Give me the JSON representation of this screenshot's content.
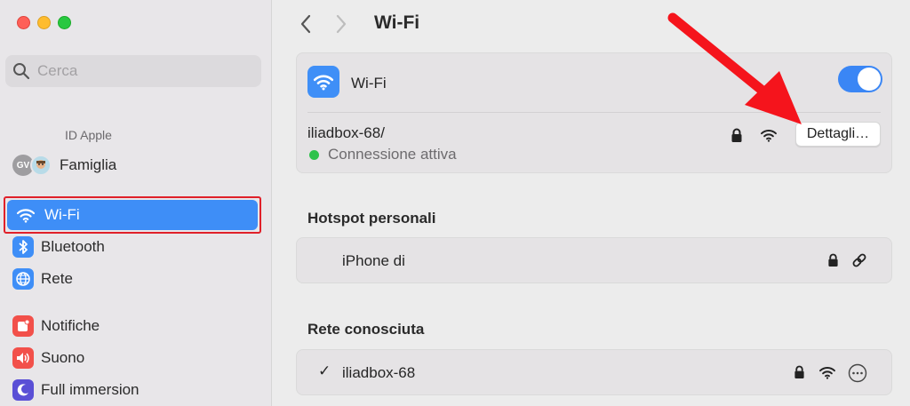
{
  "sidebar": {
    "search_placeholder": "Cerca",
    "apple_id_label": "ID Apple",
    "family": {
      "avatar_initials": "GV",
      "label": "Famiglia"
    },
    "items": [
      {
        "label": "Wi-Fi",
        "icon": "wifi-icon",
        "selected": true
      },
      {
        "label": "Bluetooth",
        "icon": "bluetooth-icon"
      },
      {
        "label": "Rete",
        "icon": "globe-icon"
      },
      {
        "label": "Notifiche",
        "icon": "bell-icon"
      },
      {
        "label": "Suono",
        "icon": "speaker-icon"
      },
      {
        "label": "Full immersion",
        "icon": "moon-icon"
      }
    ]
  },
  "header": {
    "title": "Wi-Fi"
  },
  "wifi_card": {
    "label": "Wi-Fi",
    "toggle_on": true,
    "network_name": "iliadbox-68/",
    "status": "Connessione attiva",
    "details_button": "Dettagli…"
  },
  "hotspot": {
    "heading": "Hotspot personali",
    "item": "iPhone di"
  },
  "known": {
    "heading": "Rete conosciuta",
    "check": "✓",
    "item": "iliadbox-68"
  },
  "colors": {
    "accent": "#3e8ef7",
    "annotation_red": "#e0202a",
    "status_green": "#2ec24b"
  }
}
